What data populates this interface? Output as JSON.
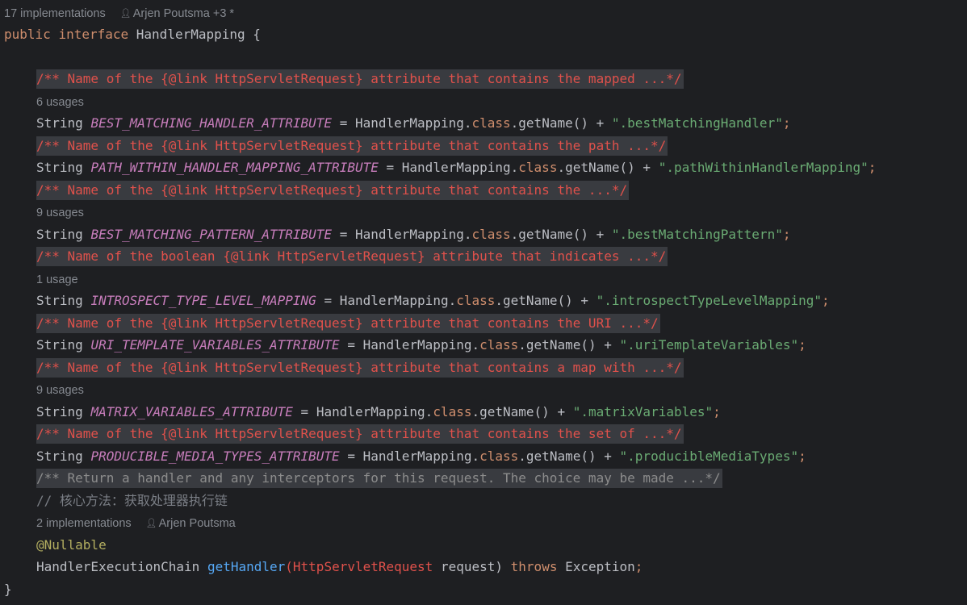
{
  "header": {
    "implementations": "17 implementations",
    "authors": "Arjen Poutsma +3 *"
  },
  "decl": {
    "public": "public",
    "interface": "interface",
    "name": "HandlerMapping",
    "brace_open": "{",
    "brace_close": "}"
  },
  "common": {
    "string": "String",
    "eq": "=",
    "class_ref": "HandlerMapping",
    "dot": ".",
    "class_kw": "class",
    "getname": ".getName()",
    "plus": "+",
    "semi": ";"
  },
  "fields": [
    {
      "doc": "/** Name of the {@link HttpServletRequest} attribute that contains the mapped ...*/",
      "usages": "6 usages",
      "name": "BEST_MATCHING_HANDLER_ATTRIBUTE",
      "value": "\".bestMatchingHandler\""
    },
    {
      "doc": "/** Name of the {@link HttpServletRequest} attribute that contains the path ...*/",
      "usages": "",
      "name": "PATH_WITHIN_HANDLER_MAPPING_ATTRIBUTE",
      "value": "\".pathWithinHandlerMapping\""
    },
    {
      "doc": "/** Name of the {@link HttpServletRequest} attribute that contains the ...*/",
      "usages": "9 usages",
      "name": "BEST_MATCHING_PATTERN_ATTRIBUTE",
      "value": "\".bestMatchingPattern\""
    },
    {
      "doc": "/** Name of the boolean {@link HttpServletRequest} attribute that indicates ...*/",
      "usages": "1 usage",
      "name": "INTROSPECT_TYPE_LEVEL_MAPPING",
      "value": "\".introspectTypeLevelMapping\""
    },
    {
      "doc": "/** Name of the {@link HttpServletRequest} attribute that contains the URI ...*/",
      "usages": "",
      "name": "URI_TEMPLATE_VARIABLES_ATTRIBUTE",
      "value": "\".uriTemplateVariables\""
    },
    {
      "doc": "/** Name of the {@link HttpServletRequest} attribute that contains a map with ...*/",
      "usages": "9 usages",
      "name": "MATRIX_VARIABLES_ATTRIBUTE",
      "value": "\".matrixVariables\""
    },
    {
      "doc": "/** Name of the {@link HttpServletRequest} attribute that contains the set of ...*/",
      "usages": "",
      "name": "PRODUCIBLE_MEDIA_TYPES_ATTRIBUTE",
      "value": "\".producibleMediaTypes\""
    }
  ],
  "method": {
    "doc": "/** Return a handler and any interceptors for this request. The choice may be made ...*/",
    "comment": "// 核心方法：获取处理器执行链",
    "implementations": "2 implementations",
    "author": "Arjen Poutsma",
    "annotation": "@Nullable",
    "return_type": "HandlerExecutionChain",
    "name": "getHandler",
    "paren_open": "(",
    "param_type": "HttpServletRequest",
    "param_name": "request",
    "paren_close": ")",
    "throws": "throws",
    "exception": "Exception",
    "semi": ";"
  },
  "icons": {
    "author": "person-icon"
  },
  "colors": {
    "background": "#1e1f22",
    "doc_block_bg": "#393b40",
    "doc_text": "#e0514b",
    "keyword": "#cf8e6d",
    "field": "#c77dbb",
    "string": "#6aab73",
    "method": "#56a8f5",
    "annotation": "#b3ae60",
    "inlay": "#868a91"
  }
}
